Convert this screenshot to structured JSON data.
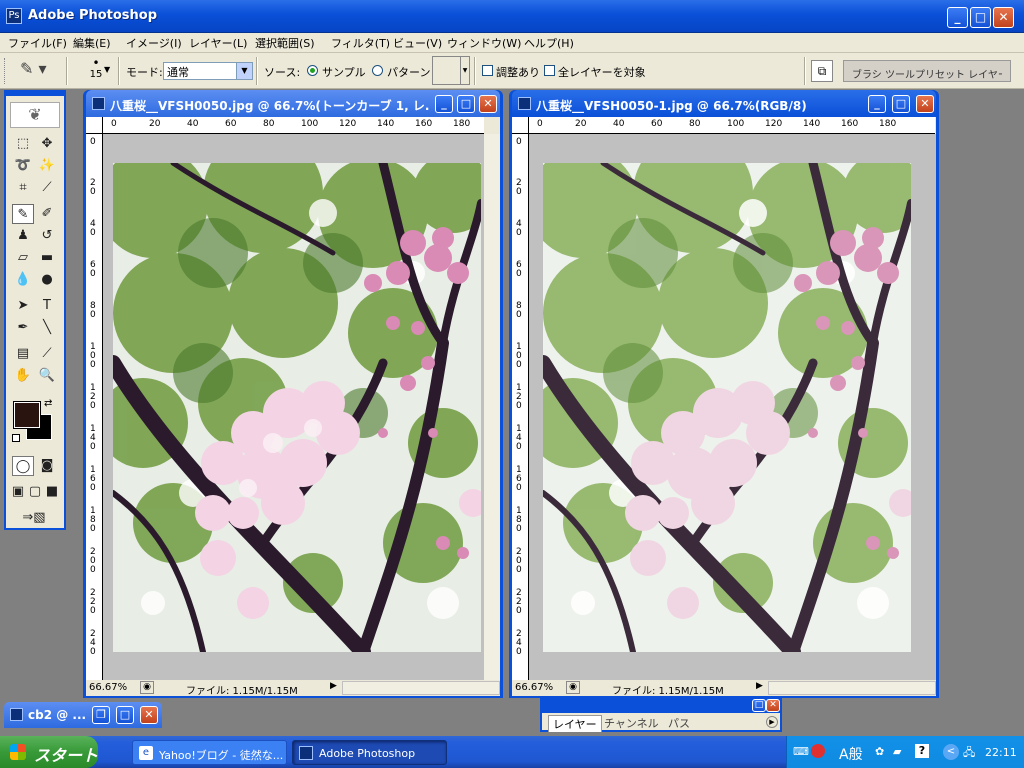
{
  "app": {
    "title": "Adobe Photoshop"
  },
  "menu": [
    "ファイル(F)",
    "編集(E)",
    "イメージ(I)",
    "レイヤー(L)",
    "選択範囲(S)",
    "フィルタ(T)",
    "ビュー(V)",
    "ウィンドウ(W)",
    "ヘルプ(H)"
  ],
  "options": {
    "brush_size": "15",
    "mode_label": "モード:",
    "mode_value": "通常",
    "source_label": "ソース:",
    "source_sampled": "サンプル",
    "source_pattern": "パターン",
    "aligned": "調整あり",
    "all_layers": "全レイヤーを対象",
    "palette_well": "ブラシ  ツールプリセット  レイヤーカンプ"
  },
  "doc1": {
    "title": "八重桜__VFSH0050.jpg @ 66.7%(トーンカーブ 1, レ...",
    "zoom": "66.67%",
    "file_info": "ファイル: 1.15M/1.15M"
  },
  "doc2": {
    "title": "八重桜__VFSH0050-1.jpg @ 66.7%(RGB/8)",
    "zoom": "66.67%",
    "file_info": "ファイル: 1.15M/1.15M"
  },
  "ruler_h": [
    "0",
    "20",
    "40",
    "60",
    "80",
    "100",
    "120",
    "140",
    "160",
    "180"
  ],
  "ruler_v": [
    "0",
    "20",
    "40",
    "60",
    "80",
    "100",
    "120",
    "140",
    "160",
    "180",
    "200",
    "220",
    "240"
  ],
  "layers_palette": {
    "tabs": [
      "レイヤー",
      "チャンネル",
      "パス"
    ]
  },
  "minimized": {
    "title": "cb2 @ ..."
  },
  "taskbar": {
    "start": "スタート",
    "tasks": [
      "Yahoo!ブログ - 徒然な...",
      "Adobe Photoshop"
    ],
    "ime": "A般",
    "clock": "22:11"
  },
  "colors": {
    "title_blue": "#0a50d8",
    "foreground": "#2a1410",
    "background": "#000000"
  }
}
